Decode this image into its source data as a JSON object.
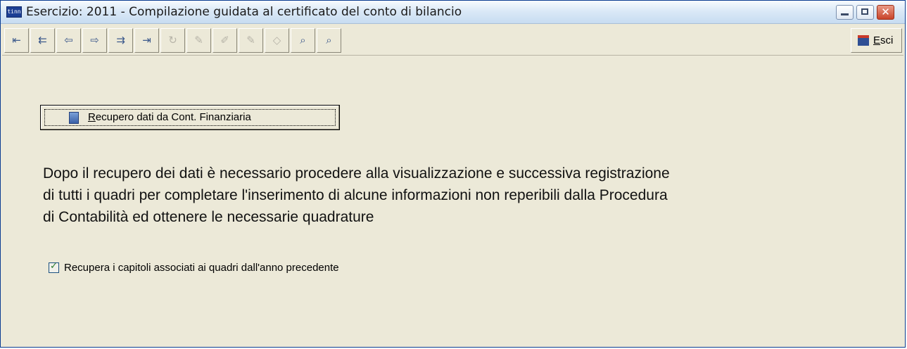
{
  "window": {
    "app_icon_text": "tinn",
    "title": "Esercizio: 2011 - Compilazione guidata al certificato del conto di bilancio",
    "minimize_symbol": "",
    "maximize_symbol": "",
    "close_symbol": "✕"
  },
  "toolbar": {
    "buttons": [
      {
        "icon": "first-record-icon",
        "glyph": "⇤",
        "enabled": true
      },
      {
        "icon": "prev-page-icon",
        "glyph": "⇇",
        "enabled": true
      },
      {
        "icon": "prev-record-icon",
        "glyph": "⇦",
        "enabled": true
      },
      {
        "icon": "next-record-icon",
        "glyph": "⇨",
        "enabled": true
      },
      {
        "icon": "next-page-icon",
        "glyph": "⇉",
        "enabled": true
      },
      {
        "icon": "last-record-icon",
        "glyph": "⇥",
        "enabled": true
      },
      {
        "icon": "refresh-icon",
        "glyph": "↻",
        "enabled": false
      },
      {
        "icon": "add-record-icon",
        "glyph": "✎",
        "enabled": false
      },
      {
        "icon": "edit-record-icon",
        "glyph": "✐",
        "enabled": false
      },
      {
        "icon": "delete-record-icon",
        "glyph": "✎",
        "enabled": false
      },
      {
        "icon": "cancel-edit-icon",
        "glyph": "◇",
        "enabled": false
      },
      {
        "icon": "search-icon",
        "glyph": "⌕",
        "enabled": true
      },
      {
        "icon": "search-more-icon",
        "glyph": "⌕",
        "enabled": true
      }
    ],
    "exit_label_accel": "E",
    "exit_label_rest": "sci"
  },
  "actions": {
    "recover_accel": "R",
    "recover_rest": "ecupero dati da Cont. Finanziaria"
  },
  "info": {
    "line1": "Dopo il recupero dei dati è necessario procedere alla visualizzazione  e successiva registrazione",
    "line2": "di tutti i quadri  per  completare l'inserimento di alcune informazioni non reperibili dalla  Procedura",
    "line3": "di Contabilità ed ottenere le necessarie quadrature"
  },
  "options": {
    "recover_chapters_checked": true,
    "recover_chapters_mark": "✓",
    "recover_chapters_label": "Recupera i capitoli associati ai quadri dall'anno precedente"
  },
  "colors": {
    "window_bg": "#ece9d8",
    "title_gradient_top": "#f7fbfe",
    "border": "#0b3d91",
    "enabled_icon": "#3d5a8c",
    "disabled_icon": "#b7b4a8"
  }
}
